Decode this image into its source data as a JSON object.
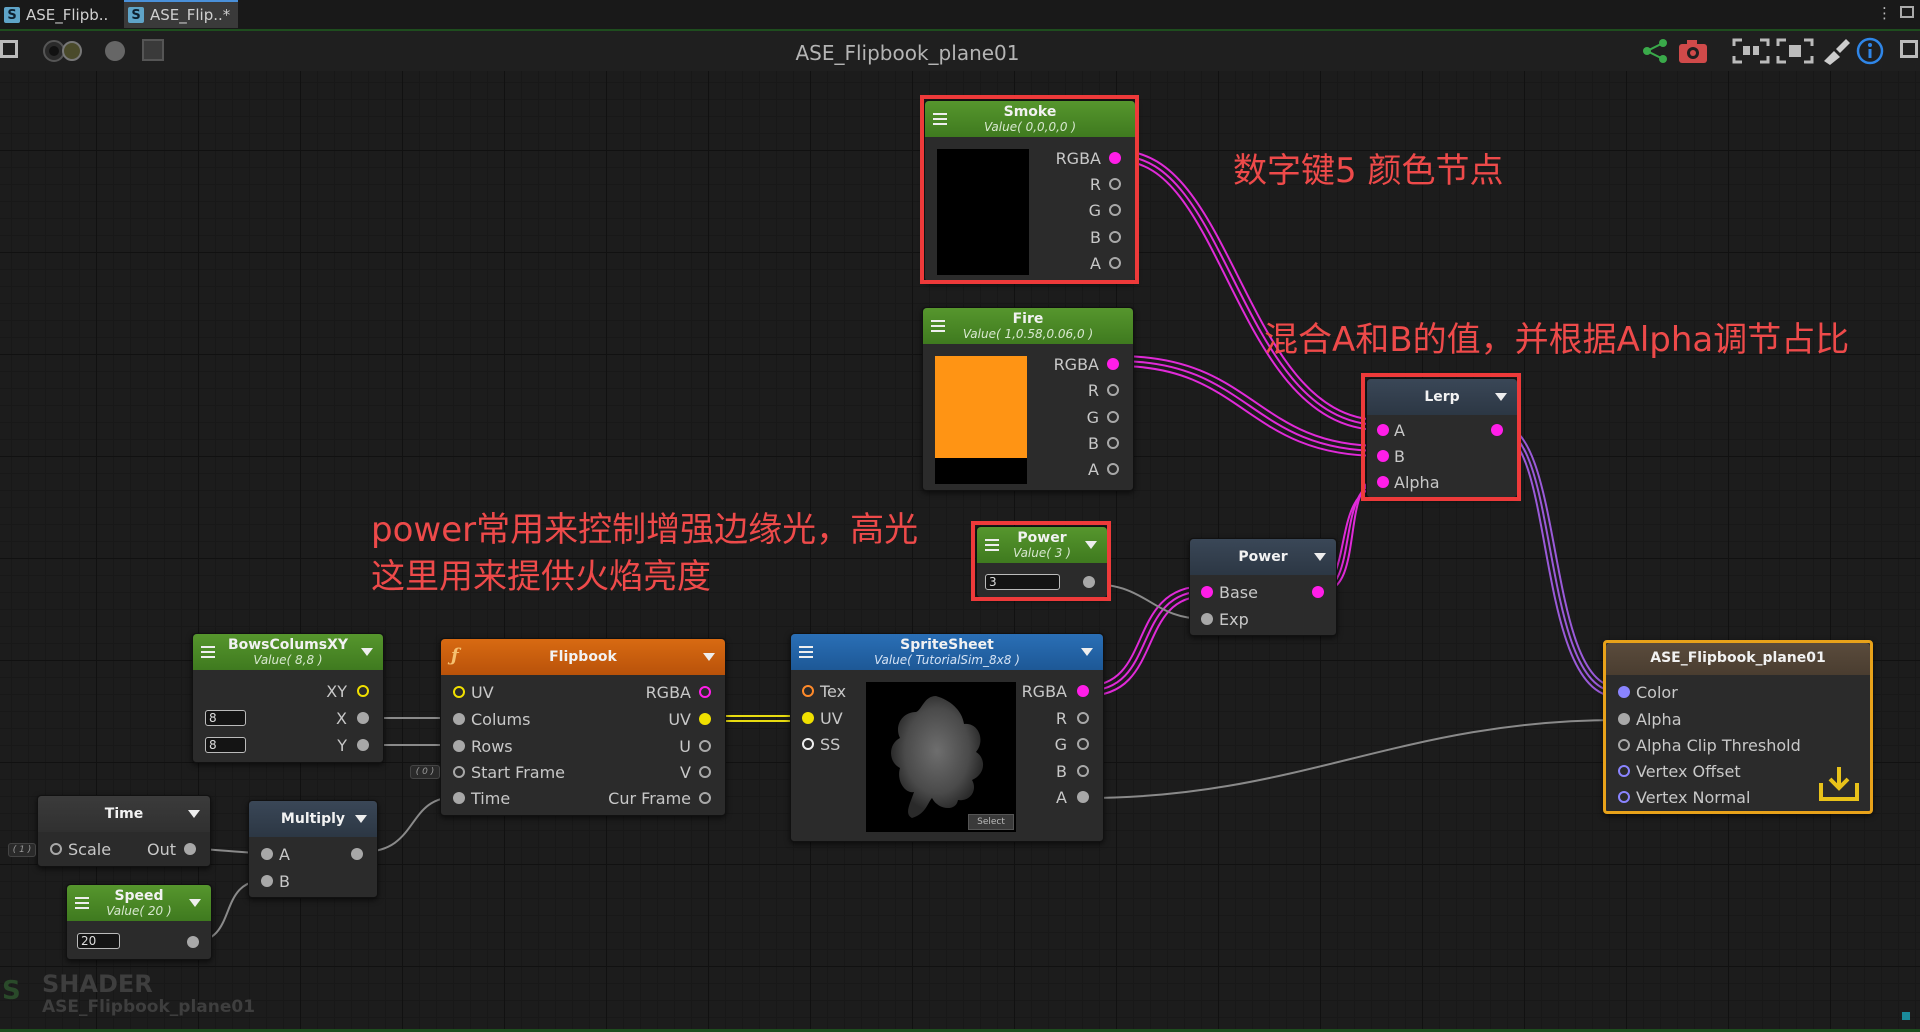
{
  "tabs": [
    {
      "label": "ASE_Flipb..",
      "icon": "shader-icon"
    },
    {
      "label": "ASE_Flip..*",
      "icon": "shader-icon"
    }
  ],
  "title": "ASE_Flipbook_plane01",
  "annotations": {
    "color_node": "数字键5 颜色节点",
    "lerp": "混合A和B的值，并根据Alpha调节占比",
    "power_line1": "power常用来控制增强边缘光，高光",
    "power_line2": "这里用来提供火焰亮度"
  },
  "nodes": {
    "smoke": {
      "title": "Smoke",
      "value": "Value( 0,0,0,0 )",
      "color": "#000000",
      "ports": [
        "RGBA",
        "R",
        "G",
        "B",
        "A"
      ]
    },
    "fire": {
      "title": "Fire",
      "value": "Value( 1,0.58,0.06,0 )",
      "color": "#ff9414",
      "ports": [
        "RGBA",
        "R",
        "G",
        "B",
        "A"
      ]
    },
    "lerp": {
      "title": "Lerp",
      "inputs": [
        "A",
        "B",
        "Alpha"
      ]
    },
    "power_const": {
      "title": "Power",
      "value": "Value( 3 )",
      "field": "3"
    },
    "power": {
      "title": "Power",
      "inputs": [
        "Base",
        "Exp"
      ]
    },
    "rows_cols": {
      "title": "BowsColumsXY",
      "value": "Value( 8,8 )",
      "out": "XY",
      "x_label": "X",
      "y_label": "Y",
      "x_field": "8",
      "y_field": "8"
    },
    "flipbook": {
      "title": "Flipbook",
      "inputs": [
        "UV",
        "Colums",
        "Rows",
        "Start Frame",
        "Time"
      ],
      "outputs": [
        "RGBA",
        "UV",
        "U",
        "V",
        "Cur Frame"
      ],
      "start_frame_default": "( 0 )"
    },
    "spritesheet": {
      "title": "SpriteSheet",
      "value": "Value( TutorialSim_8x8 )",
      "inputs": [
        "Tex",
        "UV",
        "SS"
      ],
      "outputs": [
        "RGBA",
        "R",
        "G",
        "B",
        "A"
      ],
      "select_label": "Select"
    },
    "output": {
      "title": "ASE_Flipbook_plane01",
      "inputs": [
        "Color",
        "Alpha",
        "Alpha Clip Threshold",
        "Vertex Offset",
        "Vertex Normal"
      ]
    },
    "time": {
      "title": "Time",
      "in": "Scale",
      "out": "Out",
      "scale_default": "( 1 )"
    },
    "multiply": {
      "title": "Multiply",
      "inputs": [
        "A",
        "B"
      ]
    },
    "speed": {
      "title": "Speed",
      "value": "Value( 20 )",
      "field": "20"
    }
  },
  "watermark": {
    "title": "SHADER",
    "subtitle": "ASE_Flipbook_plane01"
  }
}
